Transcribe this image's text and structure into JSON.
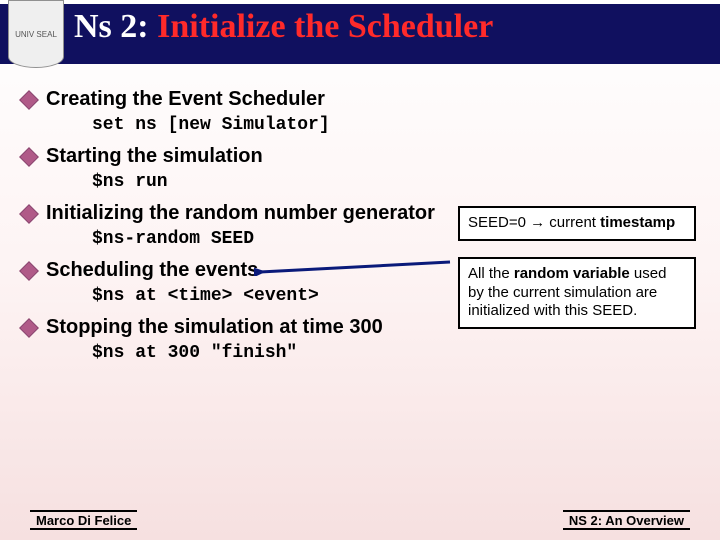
{
  "title": {
    "prefix": "Ns 2:",
    "rest": " Initialize the Scheduler"
  },
  "bullets": {
    "b1": "Creating the Event Scheduler",
    "c1": "set ns [new Simulator]",
    "b2": "Starting the simulation",
    "c2": "$ns run",
    "b3": " Initializing the random number generator",
    "c3": "$ns-random SEED",
    "b4": "Scheduling the events",
    "c4": "$ns at <time> <event>",
    "b5": "Stopping the simulation at time 300",
    "c5": "$ns at 300 \"finish\""
  },
  "callout1": {
    "seed": "SEED=0 ",
    "arrow": "→",
    "rest": " current ",
    "bold": "timestamp"
  },
  "callout2": {
    "p1": "All the ",
    "b1": "random variable",
    "p2": " used by the current simulation are initialized with this SEED."
  },
  "footer": {
    "left": "Marco Di Felice",
    "right": "NS 2: An Overview"
  },
  "crest": "UNIV SEAL"
}
